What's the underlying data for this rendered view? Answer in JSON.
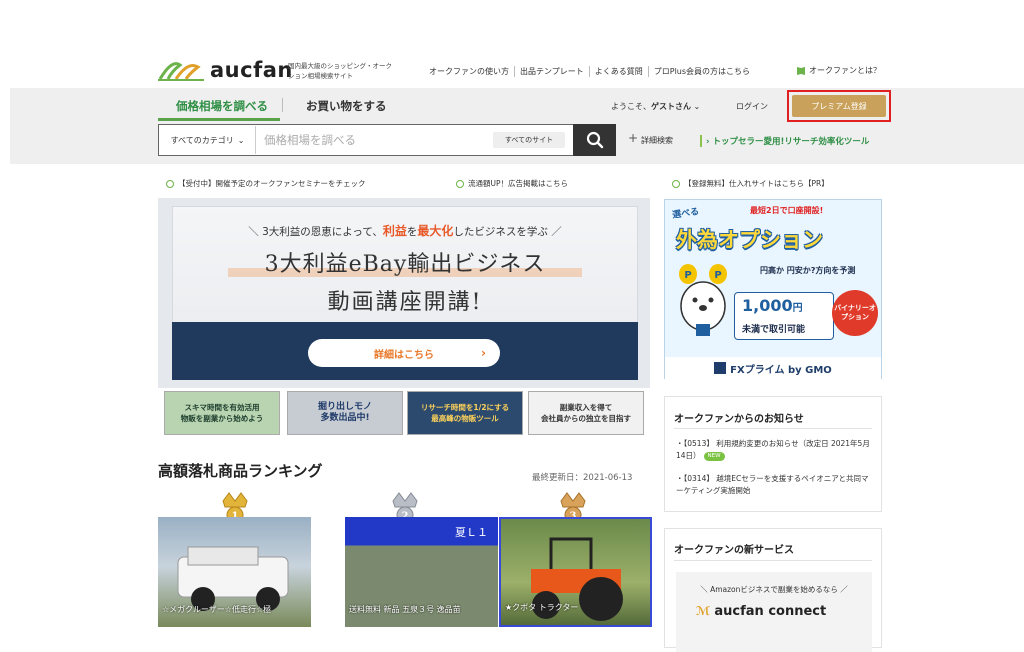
{
  "header": {
    "logo": "aucfan",
    "tagline": "国内最大級のショッピング・オークション相場検索サイト",
    "top_links": [
      "オークファンの使い方",
      "出品テンプレート",
      "よくある質問",
      "プロPlus会員の方はこちら"
    ],
    "about": "オークファンとは？"
  },
  "nav": {
    "tab_active": "価格相場を調べる",
    "tab_other": "お買い物をする",
    "welcome_prefix": "ようこそ、",
    "guest": "ゲストさん",
    "login": "ログイン",
    "premium": "プレミアム登録"
  },
  "search": {
    "category": "すべてのカテゴリ",
    "placeholder": "価格相場を調べる",
    "site": "すべてのサイト",
    "advanced": "詳細検索",
    "topseller": "トップセラー愛用!リサーチ効率化ツール"
  },
  "notices": [
    "【受付中】開催予定のオークファンセミナーをチェック",
    "流通額UP！広告掲載はこちら",
    "【登録無料】仕入れサイトはこちら【PR】"
  ],
  "hero": {
    "sub_pre": "＼ 3大利益の恩恵によって、",
    "sub_em1": "利益",
    "sub_mid": "を",
    "sub_em2": "最大化",
    "sub_post": "したビジネスを学ぶ ／",
    "title1": "3大利益eBay輸出ビジネス",
    "title2": "動画講座開講!",
    "button": "詳細はこちら"
  },
  "small_banners": [
    {
      "l1": "スキマ時間を有効活用",
      "l2": "物販を副業から始めよう"
    },
    {
      "l1": "掘り出しモノ",
      "l2": "多数出品中!"
    },
    {
      "l1": "リサーチ時間を1/2にする",
      "l2": "最高峰の物販ツール"
    },
    {
      "l1": "副業収入を得て",
      "l2": "会社員からの独立を目指す"
    }
  ],
  "fx_ad": {
    "select": "選べる",
    "top": "最短2日で口座開設!",
    "title": "外為オプション",
    "question": "円高か 円安か?方向を予測",
    "price": "1,000",
    "unit": "円",
    "price_note": "未満で取引可能",
    "binary": "バイナリーオプション",
    "brand": "FXプライム by GMO"
  },
  "news": {
    "heading": "オークファンからのお知らせ",
    "items": [
      {
        "text": "【0513】 利用規約変更のお知らせ（改定日 2021年5月14日）",
        "badge": "NEW"
      },
      {
        "text": "【0314】 越境ECセラーを支援するペイオニアと共同マーケティング実施開始",
        "badge": ""
      }
    ]
  },
  "services": {
    "heading": "オークファンの新サービス",
    "card_text": "＼ Amazonビジネスで副業を始めるなら ／",
    "card_logo": "aucfan connect"
  },
  "ranking": {
    "heading": "高額落札商品ランキング",
    "updated": "最終更新日：2021-06-13",
    "items": [
      {
        "rank": "1",
        "caption": "☆メガクルーザー☆低走行☆極"
      },
      {
        "rank": "2",
        "caption": "送料無料 新品 五泉３号 逸品苗",
        "label": "夏Ｌ１"
      },
      {
        "rank": "3",
        "caption": "★クボタ トラクター"
      }
    ]
  },
  "colors": {
    "brand_green": "#2f8f45",
    "premium_gold": "#c9a15a",
    "highlight_red": "#e02020",
    "hero_navy": "#1f3a5c"
  }
}
